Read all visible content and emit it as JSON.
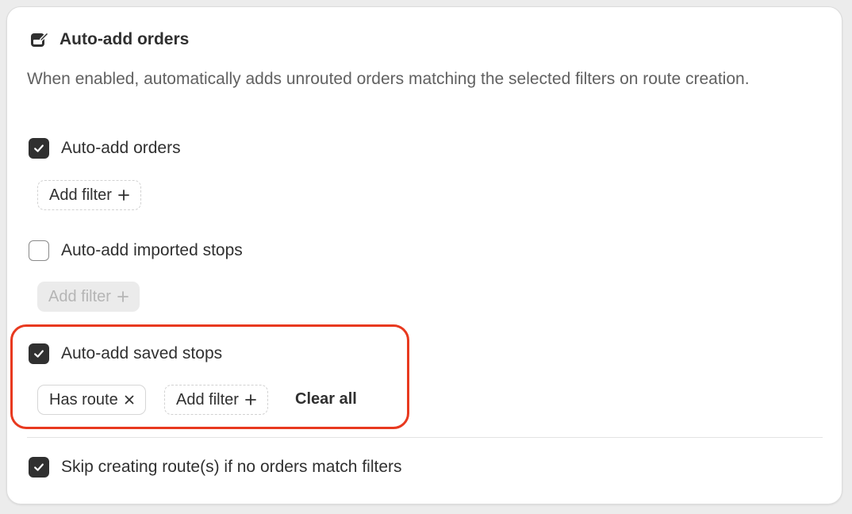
{
  "section": {
    "title": "Auto-add orders",
    "icon": "edit-calendar-icon",
    "description": "When enabled, automatically adds unrouted orders matching the selected filters on route creation."
  },
  "options": [
    {
      "label": "Auto-add orders",
      "checked": true,
      "add_filter_label": "Add filter",
      "add_filter_enabled": true
    },
    {
      "label": "Auto-add imported stops",
      "checked": false,
      "add_filter_label": "Add filter",
      "add_filter_enabled": false
    },
    {
      "label": "Auto-add saved stops",
      "checked": true,
      "applied_filters": [
        "Has route"
      ],
      "add_filter_label": "Add filter",
      "add_filter_enabled": true,
      "clear_all_label": "Clear all",
      "highlighted": true
    }
  ],
  "skip_option": {
    "label": "Skip creating route(s) if no orders match filters",
    "checked": true
  },
  "colors": {
    "checkbox_checked": "#303030",
    "highlight_border": "#e8391f",
    "disabled_chip_bg": "#ebebeb"
  }
}
